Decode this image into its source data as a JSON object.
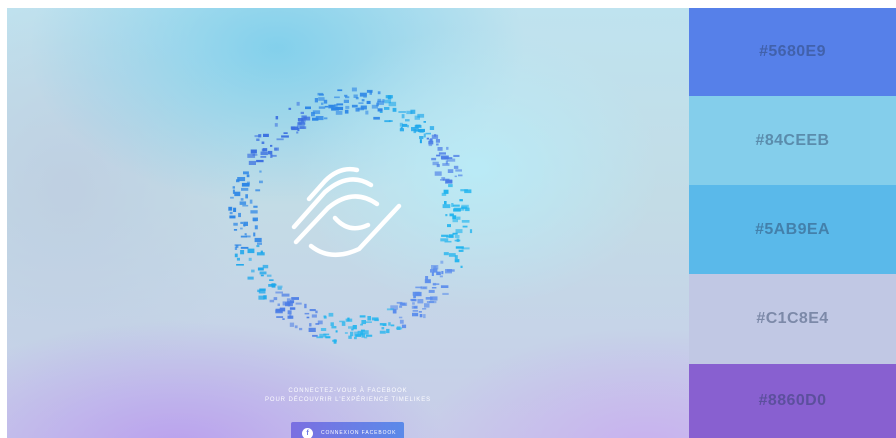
{
  "hero": {
    "cta_line1": "CONNECTEZ-VOUS À FACEBOOK",
    "cta_line2": "POUR DÉCOUVRIR L'EXPÉRIENCE TIMELIKES",
    "button_icon": "f",
    "button_label": "CONNEXION FACEBOOK",
    "icon_name": "timelikes-logo-icon"
  },
  "palette": [
    {
      "label": "#5680E9",
      "color": "#5680E9"
    },
    {
      "label": "#84CEEB",
      "color": "#84CEEB"
    },
    {
      "label": "#5AB9EA",
      "color": "#5AB9EA"
    },
    {
      "label": "#C1C8E4",
      "color": "#C1C8E4"
    },
    {
      "label": "#8860D0",
      "color": "#8860D0"
    }
  ]
}
